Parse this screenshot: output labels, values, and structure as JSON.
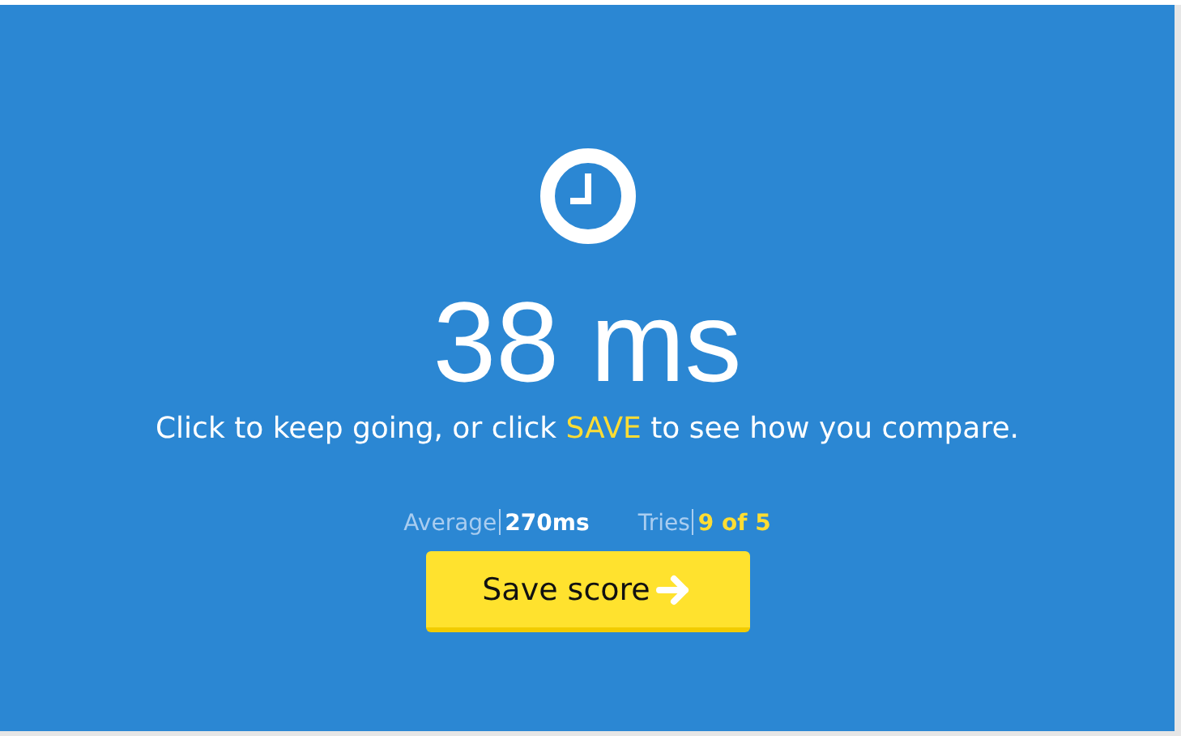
{
  "result": {
    "time": "38 ms"
  },
  "message": {
    "before": "Click to keep going, or click ",
    "highlight": "SAVE",
    "after": " to see how you compare."
  },
  "stats": [
    {
      "label": "Average",
      "value": "270ms",
      "color": "#ffffff"
    },
    {
      "label": "Tries",
      "value": "9 of 5",
      "color": "#ffdd33"
    }
  ],
  "button": {
    "label": "Save score"
  }
}
